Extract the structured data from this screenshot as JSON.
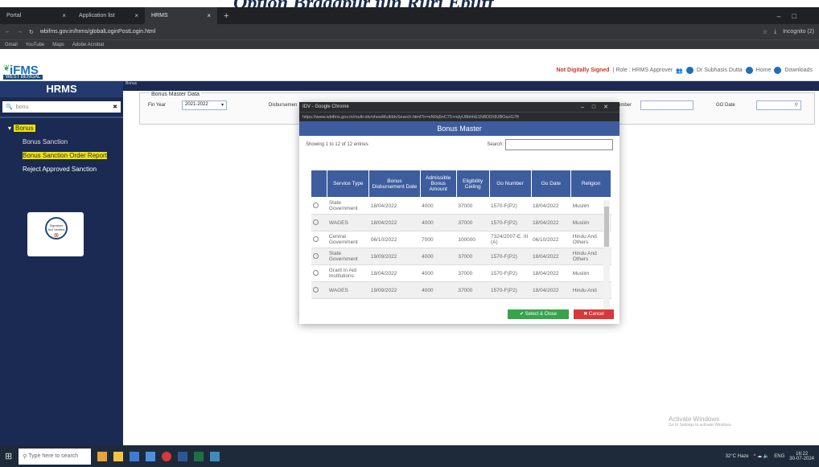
{
  "browser": {
    "tabs": [
      {
        "label": "Portal"
      },
      {
        "label": "Application list"
      },
      {
        "label": "HRMS"
      }
    ],
    "url": "wbifms.gov.in/hrms/globalLoginPostLogin.html",
    "incognito": "Incognito (2)",
    "bookmarks": [
      "Gmail",
      "YouTube",
      "Maps",
      "Adobe Acrobat"
    ]
  },
  "header": {
    "logo_text": "iFMS",
    "logo_sub": "WEST BENGAL",
    "not_signed": "Not Digitally Signed",
    "role": "| Role : HRMS Approver",
    "user": "Dr Subhasis Dutta",
    "home": "Home",
    "downloads": "Downloads"
  },
  "sidebar": {
    "title": "HRMS",
    "search_value": "bonu",
    "menu_group": "Bonus",
    "items": [
      {
        "label": "Bonus Sanction"
      },
      {
        "label": "Bonus Sanction Order Report"
      },
      {
        "label": "Reject Approved Sanction"
      }
    ],
    "signature_text": "Signature Not Verified"
  },
  "main": {
    "breadcrumb": "Bonus",
    "legend": "Bonus Master Data",
    "fin_year_label": "Fin Year",
    "fin_year_value": "2021-2022",
    "disbursement_label": "Disbursemen",
    "go_number_label": "Go Number",
    "go_date_label": "GO Date"
  },
  "popup": {
    "window_title": "IDV - Google Chrome",
    "url": "https://www.wbifms.gov.in/multi-idv/showMultiIdvSearch.html?n=eN0q5nC75+ndyU8bhhE1N8D0X8JBOanG7ft",
    "heading": "Bonus Master",
    "showing": "Showing 1 to 12 of 12 entries",
    "search_label": "Search:",
    "columns": [
      "",
      "Service Type",
      "Bonus Disbursement Date",
      "Admissible Bonus Amount",
      "Eligibility Ceiling",
      "Go Number",
      "Go Date",
      "Religion"
    ],
    "rows": [
      [
        "State Government",
        "18/04/2022",
        "4000",
        "37000",
        "1570-F(P2)",
        "18/04/2022",
        "Muslim"
      ],
      [
        "WAGES",
        "18/04/2022",
        "4000",
        "37000",
        "1570-F(P2)",
        "18/04/2022",
        "Muslim"
      ],
      [
        "Central Government",
        "06/10/2022",
        "7000",
        "100000",
        "7324/2007-E. III (A)",
        "06/10/2022",
        "Hindu And Others"
      ],
      [
        "State Government",
        "19/09/2022",
        "4000",
        "37000",
        "1570-F(P2)",
        "18/04/2022",
        "Hindu And Others"
      ],
      [
        "Grant in Aid Institutions",
        "18/04/2022",
        "4000",
        "37000",
        "1570-F(P2)",
        "18/04/2022",
        "Muslim"
      ],
      [
        "WAGES",
        "19/09/2022",
        "4000",
        "37000",
        "1570-F(P2)",
        "18/04/2022",
        "Hindu And"
      ]
    ],
    "select_close": "Select & Close",
    "cancel": "Cancel"
  },
  "watermark": {
    "title": "Activate Windows",
    "sub": "Go to Settings to activate Windows."
  },
  "taskbar": {
    "search_placeholder": "Type here to search",
    "weather": "32°C Haze",
    "lang": "ENG",
    "time": "16:22",
    "date": "30-07-2024"
  }
}
